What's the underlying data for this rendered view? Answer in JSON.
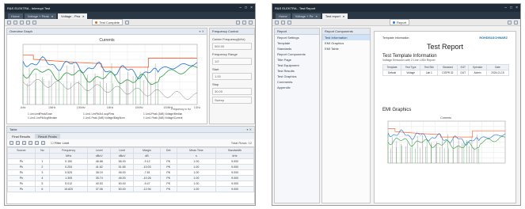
{
  "left": {
    "title": "R&S ELEKTRA - Interrupt Test",
    "tabs": [
      {
        "label": "Home",
        "active": false
      },
      {
        "label": "Voltage + Peak",
        "active": false
      },
      {
        "label": "Voltage - Pea",
        "active": true
      }
    ],
    "toolbar": {
      "test_status": "Test Complete"
    },
    "chart": {
      "panel_title": "Overview Graph",
      "title": "Currents",
      "xlabel": "Frequency in Hz",
      "legend": [
        "1 Lim:LimitPeak/Dose",
        "1 Lim1 LimPk/Avg/Median",
        "1 Lim1 LimPk/Av1.sup/Rms",
        "1 Lim1 Peak (3dB) Voltage/Mag/Nom",
        "1 Lim1/Peak (3dB) Voltage/Median",
        "1 Lim1 Peak (3dB) Voltage/Current"
      ],
      "xticks": [
        "1kHz",
        "10kHz",
        "100kHz",
        "1MHz",
        "10MHz",
        "100MHz",
        "1GHz"
      ],
      "colors": {
        "limit": "#ff6a3d",
        "series1": "#1a6fd1",
        "series2": "#2b9c3b",
        "series3": "#7a7a7a"
      }
    },
    "freq": {
      "header": "Frequency Control",
      "field_label": "Center Frequency(kHz)",
      "center": "500.00",
      "range_label": "Frequency Range",
      "range_val": "1/2",
      "start_label": "Start",
      "start_val": "1.00",
      "stop_label": "Stop",
      "stop_val": "30.00",
      "sweep_label": "Sweep"
    },
    "table": {
      "header": "Table",
      "tabs": [
        "Final Results",
        "Result Peaks"
      ],
      "filter_label": "Filter Limit",
      "count": "Total Rows: 12",
      "columns": [
        "Source",
        "No",
        "Frequency",
        "Level",
        "Limit",
        "Margin",
        "Det",
        "Meas Time",
        "Bandwidth"
      ],
      "units": [
        "",
        "",
        "MHz",
        "dBuV",
        "dBuV",
        "dB",
        "",
        "s",
        "kHz"
      ],
      "rows": [
        [
          "Pk",
          "1",
          "0.150",
          "46.88",
          "56.00",
          "-9.12",
          "PK",
          "1.00",
          "9.000"
        ],
        [
          "Pk",
          "2",
          "0.253",
          "41.62",
          "51.65",
          "-10.03",
          "PK",
          "1.00",
          "9.000"
        ],
        [
          "Pk",
          "3",
          "0.525",
          "38.19",
          "46.00",
          "-7.81",
          "PK",
          "1.00",
          "9.000"
        ],
        [
          "Pk",
          "4",
          "1.305",
          "35.74",
          "46.00",
          "-10.26",
          "PK",
          "1.00",
          "9.000"
        ],
        [
          "Pk",
          "5",
          "5.012",
          "40.53",
          "50.00",
          "-9.47",
          "PK",
          "1.00",
          "9.000"
        ],
        [
          "Pk",
          "6",
          "15.820",
          "37.06",
          "50.00",
          "-12.94",
          "PK",
          "1.00",
          "9.000"
        ]
      ]
    }
  },
  "right": {
    "title": "R&S ELEKTRA - Test Report",
    "tabs": [
      {
        "label": "Home",
        "active": false
      },
      {
        "label": "Voltage + Pe",
        "active": false
      },
      {
        "label": "Test report",
        "active": true
      }
    ],
    "nav_header": "Report",
    "nav_items": [
      "Report Settings",
      "Template",
      "Standards",
      "Report Components",
      "Title Page",
      "Test Equipment",
      "Test Results",
      "Test Graphics",
      "Comments",
      "Appendix"
    ],
    "component_header": "Report Components",
    "components": [
      "Test Information",
      "EMI Graphics",
      "EMI Table"
    ],
    "paper": {
      "header_line": "Template Information",
      "title": "Test Report",
      "sec1": "Test Template Information",
      "sec1_line": "Voltage Emission with 2 Line LISN Report",
      "info_cols": [
        "Template",
        "Test Type",
        "Test Site",
        "Standard",
        "EUT",
        "Operator",
        "Date"
      ],
      "info_vals": [
        "Default",
        "Voltage",
        "Lab 1",
        "CISPR 32",
        "DUT",
        "Admin",
        "2024-01-15"
      ],
      "sec2": "EMI Graphics",
      "graph_title": "Currents",
      "brand": "ROHDE&SCHWARZ"
    }
  }
}
